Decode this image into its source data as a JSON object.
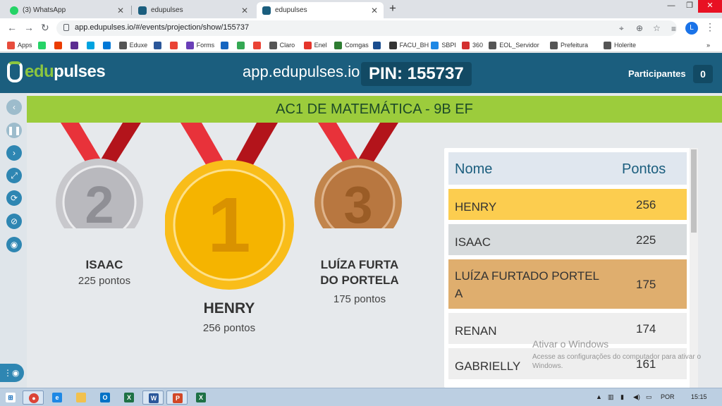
{
  "browser": {
    "tabs": [
      {
        "title": "(3) WhatsApp",
        "color": "#25d366"
      },
      {
        "title": "edupulses",
        "color": "#1b5e7e"
      },
      {
        "title": "edupulses",
        "color": "#1b5e7e"
      }
    ],
    "url": "app.edupulses.io/#/events/projection/show/155737",
    "profile_initial": "L",
    "bookmarks": [
      {
        "label": "Apps",
        "color": "#e74c3c"
      },
      {
        "label": "",
        "color": "#25d366"
      },
      {
        "label": "",
        "color": "#eb3c00"
      },
      {
        "label": "",
        "color": "#5c2d91"
      },
      {
        "label": "",
        "color": "#00a3e0"
      },
      {
        "label": "",
        "color": "#0078d7"
      },
      {
        "label": "Eduxe",
        "color": "#555555"
      },
      {
        "label": "",
        "color": "#2b579a"
      },
      {
        "label": "",
        "color": "#ea4335"
      },
      {
        "label": "Forms",
        "color": "#6a3fb8"
      },
      {
        "label": "",
        "color": "#1565c0"
      },
      {
        "label": "",
        "color": "#34a853"
      },
      {
        "label": "",
        "color": "#ea4335"
      },
      {
        "label": "Claro",
        "color": "#555555"
      },
      {
        "label": "Enel",
        "color": "#e5352b"
      },
      {
        "label": "Comgas",
        "color": "#2e7d32"
      },
      {
        "label": "",
        "color": "#1a4d8f"
      },
      {
        "label": "FACU_BH",
        "color": "#333333"
      },
      {
        "label": "SBPI",
        "color": "#1e88e5"
      },
      {
        "label": "360",
        "color": "#d32f2f"
      },
      {
        "label": "EOL_Servidor",
        "color": "#555555"
      },
      {
        "label": "Prefeitura",
        "color": "#555555"
      },
      {
        "label": "Holerite",
        "color": "#555555"
      }
    ]
  },
  "header": {
    "logo_edu": "edu",
    "logo_pulses": "pulses",
    "host": "app.edupulses.io",
    "pin_label": "PIN: 155737",
    "participants_label": "Participantes",
    "participants_count": "0"
  },
  "title": "AC1 DE MATEMÁTICA - 9B EF",
  "podium": [
    {
      "place": "2",
      "name": "ISAAC",
      "points": "225 pontos",
      "color": "#c8c8cc",
      "inner": "#b9b9be",
      "digit": "#8f8f95"
    },
    {
      "place": "1",
      "name": "HENRY",
      "points": "256 pontos",
      "color": "#f9bd1a",
      "inner": "#f5b400",
      "digit": "#d99200"
    },
    {
      "place": "3",
      "name": "LUÍZA FURTA\nDO PORTELA",
      "points": "175 pontos",
      "color": "#c2854c",
      "inner": "#b87740",
      "digit": "#9a5c26"
    }
  ],
  "ranking": {
    "col_name": "Nome",
    "col_points": "Pontos",
    "rows": [
      {
        "name": "HENRY",
        "points": "256",
        "bg": "#fccd4f"
      },
      {
        "name": "ISAAC",
        "points": "225",
        "bg": "#d7dbdd"
      },
      {
        "name": "LUÍZA FURTADO PORTEL\nA",
        "points": "175",
        "bg": "#dfae6e"
      },
      {
        "name": "RENAN",
        "points": "174",
        "bg": "#eeeeee"
      },
      {
        "name": "GABRIELLY",
        "points": "161",
        "bg": "#eeeeee"
      }
    ]
  },
  "watermark": {
    "title": "Ativar o Windows",
    "body": "Acesse as configurações do computador para ativar o Windows."
  },
  "taskbar": {
    "language": "POR",
    "time": "15:15"
  }
}
